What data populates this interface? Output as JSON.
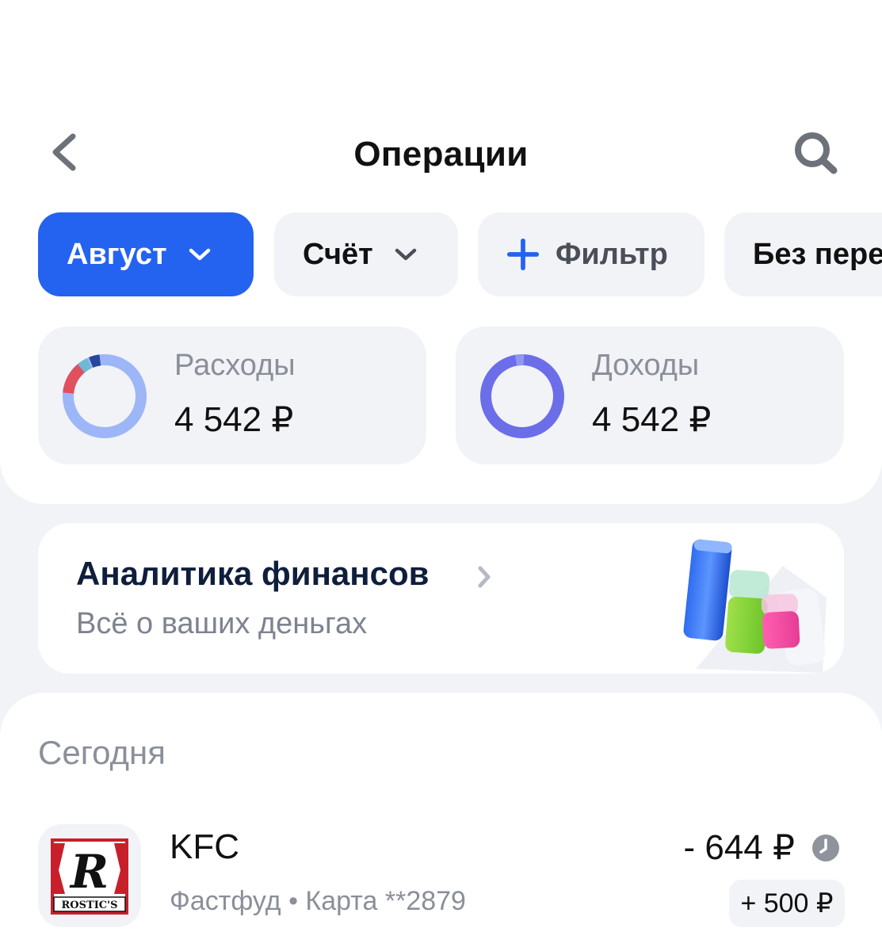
{
  "header": {
    "title": "Операции"
  },
  "filters": {
    "month": "Август",
    "account": "Счёт",
    "filter_plus": "+",
    "filter": "Фильтр",
    "transfers": "Без пере"
  },
  "summary": {
    "expenses": {
      "label": "Расходы",
      "value": "4 542 ₽"
    },
    "income": {
      "label": "Доходы",
      "value": "4 542 ₽"
    }
  },
  "colors": {
    "accent": "#2462f0",
    "expenses_ring": "#9db6f7",
    "income_ring": "#6b6ee8",
    "expense_segment_red": "#e0505e",
    "expense_segment_teal": "#6fb8d6",
    "expense_segment_navy": "#27479a"
  },
  "analytics": {
    "title": "Аналитика финансов",
    "subtitle": "Всё о ваших деньгах"
  },
  "operations": {
    "section_title": "Сегодня",
    "items": [
      {
        "merchant": "KFC",
        "category_account": "Фастфуд • Карта **2879",
        "amount": "- 644 ₽",
        "bonus": "+ 500 ₽",
        "logo_text": "ROSTIC'S",
        "logo_letter": "R"
      }
    ]
  },
  "icons": {
    "back": "chevron-left-icon",
    "search": "search-icon",
    "dropdown": "chevron-down-icon",
    "analytics_arrow": "chevron-right-icon",
    "pending": "clock-icon"
  }
}
